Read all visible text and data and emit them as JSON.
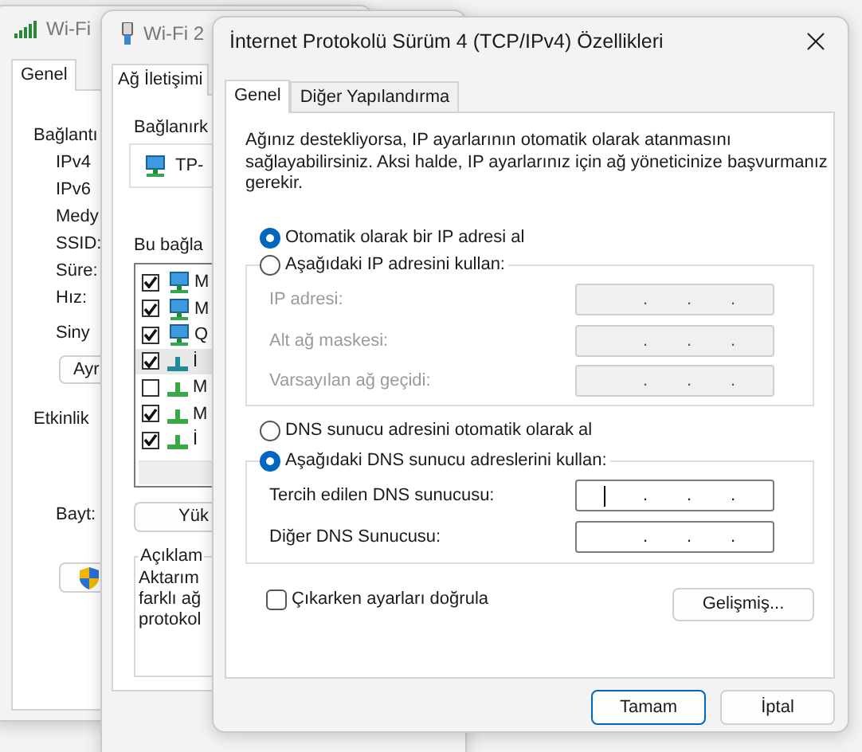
{
  "status_window": {
    "title": "Wi-Fi",
    "tabs": [
      {
        "label": "Genel",
        "selected": true
      }
    ],
    "connection_heading": "Bağlantı",
    "connection_fields": [
      "IPv4",
      "IPv6",
      "Medy",
      "SSID:",
      "Süre:",
      "Hız:"
    ],
    "signal_label": "Siny",
    "details_button": "Ayr",
    "activity_heading": "Etkinlik",
    "bytes_label": "Bayt:"
  },
  "properties_window": {
    "title": "Wi-Fi 2",
    "tabs": [
      {
        "label": "Ağ İletişimi",
        "selected": true
      }
    ],
    "connect_using_label": "Bağlanırk",
    "adapter_name": "TP-",
    "items_label": "Bu bağla",
    "items": [
      {
        "kind": "adapter",
        "label": "M",
        "checked": true,
        "selected": false
      },
      {
        "kind": "adapter",
        "label": "M",
        "checked": true,
        "selected": false
      },
      {
        "kind": "adapter",
        "label": "Q",
        "checked": true,
        "selected": false
      },
      {
        "kind": "protocol",
        "label": "İ",
        "checked": true,
        "selected": true
      },
      {
        "kind": "protocol",
        "label": "M",
        "checked": false,
        "selected": false
      },
      {
        "kind": "protocol",
        "label": "M",
        "checked": true,
        "selected": false
      },
      {
        "kind": "protocol",
        "label": "İ",
        "checked": true,
        "selected": false
      }
    ],
    "install_button": "Yük",
    "description_heading": "Açıklam",
    "description_lines": [
      "Aktarım",
      "farklı ağ",
      "protokol"
    ]
  },
  "ipv4_dialog": {
    "title": "İnternet Protokolü Sürüm 4 (TCP/IPv4) Özellikleri",
    "tabs": [
      {
        "label": "Genel",
        "selected": true
      },
      {
        "label": "Diğer Yapılandırma",
        "selected": false
      }
    ],
    "intro": "Ağınız destekliyorsa, IP ayarlarının otomatik olarak atanmasını sağlayabilirsiniz. Aksi halde, IP ayarlarınız için ağ yöneticinize başvurmanız gerekir.",
    "ip_options": [
      {
        "label": "Otomatik olarak bir IP adresi al",
        "selected": true
      },
      {
        "label": "Aşağıdaki IP adresini kullan:",
        "selected": false
      }
    ],
    "ip_fields": [
      {
        "label": "IP adresi:",
        "value": ".        .        .",
        "disabled": true,
        "focused": false
      },
      {
        "label": "Alt ağ maskesi:",
        "value": ".        .        .",
        "disabled": true,
        "focused": false
      },
      {
        "label": "Varsayılan ağ geçidi:",
        "value": ".        .        .",
        "disabled": true,
        "focused": false
      }
    ],
    "dns_options": [
      {
        "label": "DNS sunucu adresini otomatik olarak al",
        "selected": false
      },
      {
        "label": "Aşağıdaki DNS sunucu adreslerini kullan:",
        "selected": true
      }
    ],
    "dns_fields": [
      {
        "label": "Tercih edilen DNS sunucusu:",
        "value": ".        .        .",
        "disabled": false,
        "focused": true
      },
      {
        "label": "Diğer DNS Sunucusu:",
        "value": ".        .        .",
        "disabled": false,
        "focused": false
      }
    ],
    "validate_checkbox": {
      "label": "Çıkarken ayarları doğrula",
      "checked": false
    },
    "advanced_button": "Gelişmiş...",
    "buttons": [
      {
        "label": "Tamam",
        "default": true
      },
      {
        "label": "İptal",
        "default": false
      }
    ]
  }
}
